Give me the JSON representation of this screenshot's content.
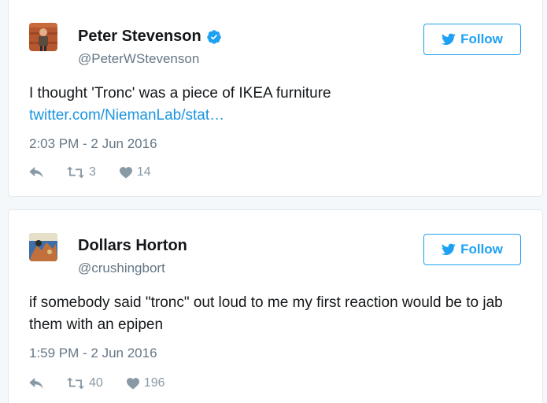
{
  "tweets": [
    {
      "author_name": "Peter Stevenson",
      "handle": "@PeterWStevenson",
      "verified": true,
      "follow_label": "Follow",
      "text": "I thought 'Tronc' was a piece of IKEA furniture",
      "link_text": "twitter.com/NiemanLab/stat…",
      "timestamp": "2:03 PM - 2 Jun 2016",
      "retweets": "3",
      "likes": "14"
    },
    {
      "author_name": "Dollars Horton",
      "handle": "@crushingbort",
      "verified": false,
      "follow_label": "Follow",
      "text": "if somebody said \"tronc\" out loud to me my first reaction would be to jab them with an epipen",
      "timestamp": "1:59 PM - 2 Jun 2016",
      "retweets": "40",
      "likes": "196"
    }
  ],
  "colors": {
    "accent": "#1da1f2",
    "link": "#1b95e0",
    "muted": "#657786",
    "icon": "#8899a6"
  },
  "icons": [
    "verified-badge-icon",
    "twitter-bird-icon",
    "reply-icon",
    "retweet-icon",
    "heart-icon"
  ]
}
